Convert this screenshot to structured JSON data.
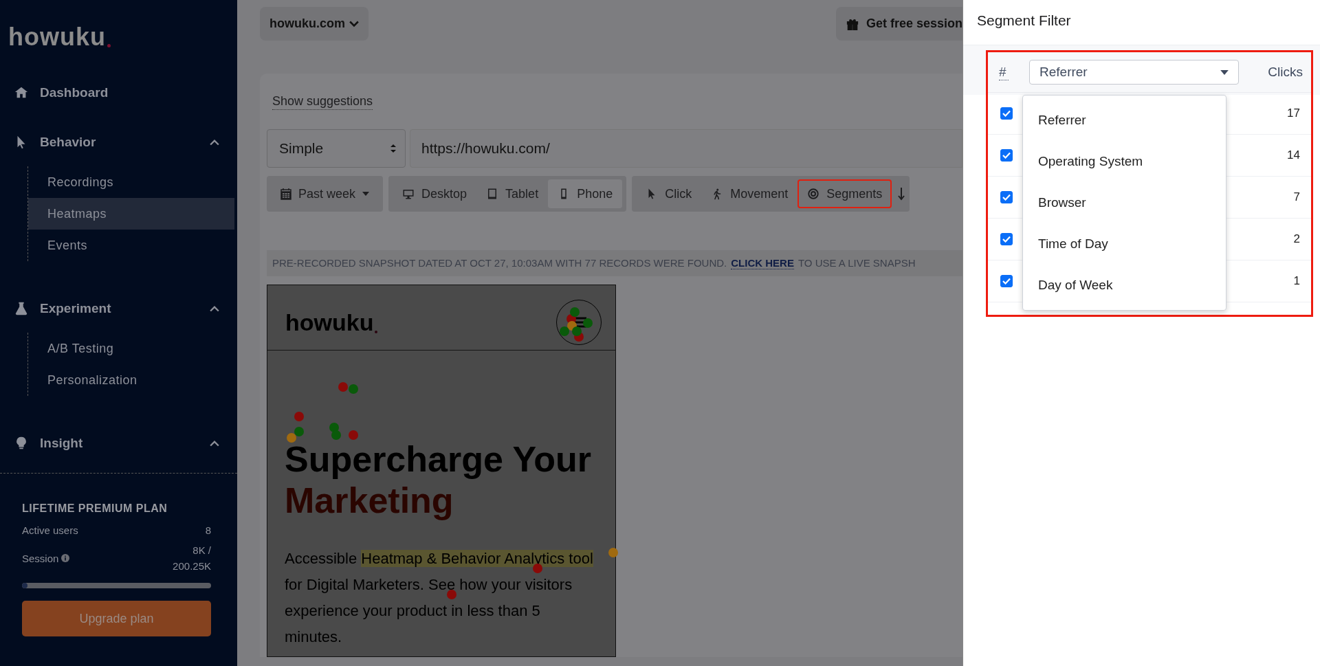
{
  "sidebar": {
    "logo": "howuku",
    "nav": [
      {
        "kind": "link",
        "label": "Dashboard"
      },
      {
        "kind": "group",
        "label": "Behavior",
        "expanded": true,
        "children": [
          {
            "label": "Recordings",
            "selected": false
          },
          {
            "label": "Heatmaps",
            "selected": true
          },
          {
            "label": "Events",
            "selected": false
          }
        ]
      },
      {
        "kind": "group",
        "label": "Experiment",
        "expanded": true,
        "children": [
          {
            "label": "A/B Testing",
            "selected": false
          },
          {
            "label": "Personalization",
            "selected": false
          }
        ]
      },
      {
        "kind": "group",
        "label": "Insight",
        "expanded": true
      }
    ],
    "plan": {
      "title": "LIFETIME PREMIUM PLAN",
      "active_users_label": "Active users",
      "active_users": "8",
      "session_label": "Session",
      "session_used": "8K /",
      "session_total": "200.25K",
      "level": 0.03,
      "button": "Upgrade plan"
    }
  },
  "topbar": {
    "domain": "howuku.com",
    "gift_button": "Get free session"
  },
  "card": {
    "suggestions_link": "Show suggestions",
    "mode_select": "Simple",
    "url": "https://howuku.com/",
    "date_filter": "Past week",
    "devices": [
      {
        "label": "Desktop",
        "selected": false
      },
      {
        "label": "Tablet",
        "selected": false
      },
      {
        "label": "Phone",
        "selected": true
      }
    ],
    "modes": [
      {
        "label": "Click",
        "highlighted": false
      },
      {
        "label": "Movement",
        "highlighted": false
      },
      {
        "label": "Segments",
        "highlighted": true
      }
    ],
    "notice": {
      "text": "PRE-RECORDED SNAPSHOT DATED AT OCT 27, 10:03AM WITH 77 RECORDS WERE FOUND.",
      "link": "CLICK HERE",
      "after": "TO USE A LIVE SNAPSH"
    }
  },
  "preview": {
    "logo": "howuku",
    "headline": "Supercharge Your",
    "headline_accent": "Marketing",
    "body_start": "Accessible ",
    "body_highlight": "Heatmap & Behavior Analytics tool",
    "body_end": " for Digital Marketers. See how your visitors experience your product in less than 5 minutes."
  },
  "segment_filter": {
    "title": "Segment Filter",
    "highlighted": true,
    "index_header": "#",
    "dimension": "Referrer",
    "clicks_header": "Clicks",
    "rows": [
      {
        "checked": true,
        "clicks": "17"
      },
      {
        "checked": true,
        "clicks": "14"
      },
      {
        "checked": true,
        "clicks": "7"
      },
      {
        "checked": true,
        "clicks": "2"
      },
      {
        "checked": true,
        "clicks": "1"
      }
    ],
    "dropdown_open": true,
    "options": [
      "Referrer",
      "Operating System",
      "Browser",
      "Time of Day",
      "Day of Week"
    ]
  }
}
